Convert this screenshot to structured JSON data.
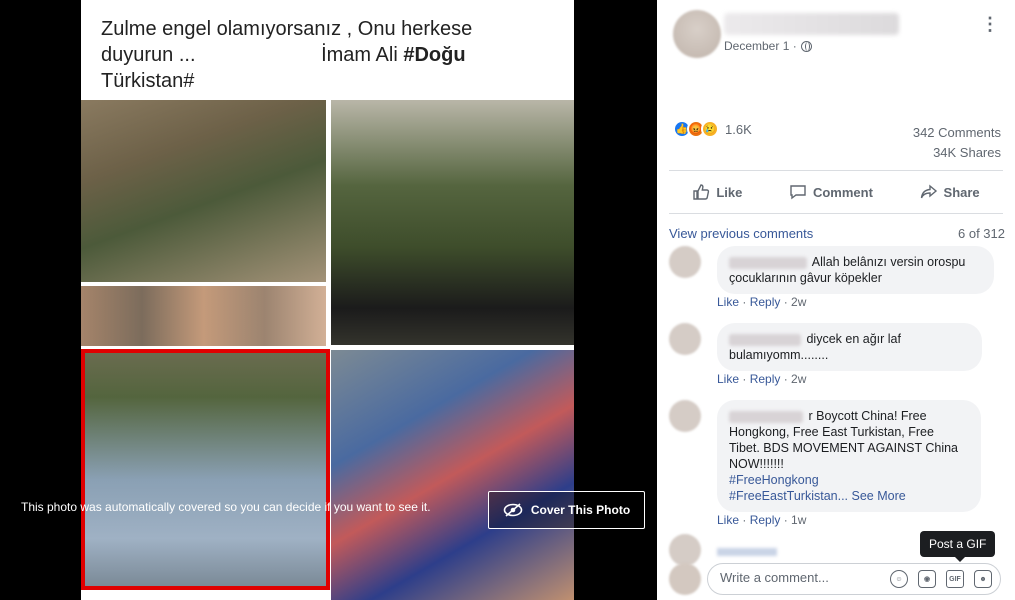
{
  "photo": {
    "text_line1": "Zulme engel olamıyorsanız , Onu herkese",
    "text_line2a": "duyurun      ...",
    "text_line2b": "İmam Ali",
    "text_hashtag1": "#Doğu",
    "text_line3": "Türkistan#",
    "cover_caption": "This photo was automatically covered so you can decide if you want to see it.",
    "cover_button": "Cover This Photo"
  },
  "post": {
    "date": "December 1 · ",
    "reaction_count": "1.6K",
    "comments_count": "342 Comments",
    "shares_count": "34K Shares"
  },
  "actions": {
    "like": "Like",
    "comment": "Comment",
    "share": "Share"
  },
  "comments_header": {
    "view_previous": "View previous comments",
    "pager": "6 of 312"
  },
  "comments": [
    {
      "line1": "Allah belânızı versin orospu",
      "line2": "çocuklarının gâvur köpekler",
      "like": "Like",
      "reply": "Reply",
      "time": "2w"
    },
    {
      "line1": "diycek en ağır laf",
      "line2": "bulamıyomm........",
      "like": "Like",
      "reply": "Reply",
      "time": "2w"
    },
    {
      "line1": "r Boycott China! Free",
      "line2": "Hongkong, Free East Turkistan, Free",
      "line3": "Tibet. BDS MOVEMENT AGAINST China",
      "line4": "NOW!!!!!!!",
      "tag1": "#FreeHongkong",
      "tag2": "#FreeEastTurkistan",
      "see_more": "... See More",
      "like": "Like",
      "reply": "Reply",
      "time": "1w"
    }
  ],
  "composer": {
    "placeholder": "Write a comment...",
    "gif_label": "GIF",
    "tooltip": "Post a GIF"
  },
  "icons": [
    "globe-icon",
    "more-icon",
    "like-reaction-icon",
    "angry-reaction-icon",
    "sad-reaction-icon",
    "thumbs-up-icon",
    "comment-icon",
    "share-icon",
    "eye-slash-icon",
    "emoji-icon",
    "camera-icon",
    "gif-icon",
    "sticker-icon"
  ]
}
